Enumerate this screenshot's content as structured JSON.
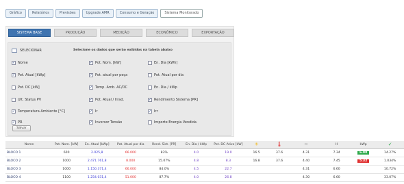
{
  "topnav": [
    {
      "label": "Gráfico",
      "active": false
    },
    {
      "label": "Relatórios",
      "active": false
    },
    {
      "label": "Previsões",
      "active": false
    },
    {
      "label": "Upgrade AMR",
      "active": false
    },
    {
      "label": "Consumo e Geração",
      "active": false
    },
    {
      "label": "Sistema Monitorado",
      "active": true
    }
  ],
  "subtabs": [
    {
      "label": "SISTEMA BASE",
      "active": true
    },
    {
      "label": "PRODUÇÃO",
      "active": false
    },
    {
      "label": "MEDIÇÃO",
      "active": false
    },
    {
      "label": "ECONÔMICO",
      "active": false
    },
    {
      "label": "EXPORTAÇÃO",
      "active": false
    }
  ],
  "selection": {
    "label": "SELECIONAR",
    "note": "Selecione os dados que serão exibidos na tabela abaixo"
  },
  "options": [
    {
      "label": "Nome",
      "checked": true
    },
    {
      "label": "Pot. Nom. [kW]",
      "checked": true
    },
    {
      "label": "En. Dia [kWh]",
      "checked": false
    },
    {
      "label": "Pot. Atual [kWp]",
      "checked": true
    },
    {
      "label": "Pot. atual por peça",
      "checked": true
    },
    {
      "label": "Pot. Atual por dia",
      "checked": false
    },
    {
      "label": "Pot. DC [kW]",
      "checked": false
    },
    {
      "label": "Temp. Amb. AC/DC",
      "checked": true
    },
    {
      "label": "En. Dia / kWp",
      "checked": false
    },
    {
      "label": "Ult. Status PV",
      "checked": false
    },
    {
      "label": "Pot. Atual / Irrad.",
      "checked": true
    },
    {
      "label": "Rendimento Sistema [PR]",
      "checked": true
    },
    {
      "label": "Temperatura Ambiente [°C]",
      "checked": true
    },
    {
      "label": "Ir",
      "checked": true
    },
    {
      "label": "Irr",
      "checked": true
    },
    {
      "label": "PR",
      "checked": true
    },
    {
      "label": "Inversor Tensão",
      "checked": true
    },
    {
      "label": "Importe Energia Vendida",
      "checked": false
    }
  ],
  "button": "Salvar",
  "table": {
    "headers": [
      "Nome",
      "Pot. Nom. [kW]",
      "En. Atual [kWp]",
      "Pot. Atual por dia",
      "Rend. Sist. [PR]",
      "En. Dia / kWp",
      "Pot. DC Ativo [kW]",
      "☀",
      "🌡",
      "~",
      "H",
      "kWp",
      "✓"
    ],
    "rows": [
      [
        "BLOCO 1",
        "600",
        "2.025,8",
        "66.000",
        "83%",
        "4.0",
        "19.0",
        "16.5",
        "37.6",
        "4.31",
        "7.34",
        "6.90",
        "14.27%"
      ],
      [
        "BLOCO 2",
        "1000",
        "2.471.761,8",
        "8.000",
        "15.07%",
        "4.8",
        "8.3",
        "16.8",
        "37.6",
        "4.40",
        "7.45",
        "5.32",
        "1.034%"
      ],
      [
        "BLOCO 3",
        "1000",
        "1.150.371,4",
        "66.000",
        "84.0%",
        "4.5",
        "22.7",
        "",
        "",
        "4.31",
        "6.60",
        "",
        "10.72%"
      ],
      [
        "BLOCO 4",
        "1100",
        "1.254.031,4",
        "51.000",
        "87.7%",
        "4.0",
        "26.8",
        "",
        "",
        "4.30",
        "6.60",
        "",
        "33.07%"
      ]
    ]
  },
  "colors": {
    "accent": "#3f74b0",
    "good": "#2ea94b",
    "bad": "#e02e2e"
  }
}
